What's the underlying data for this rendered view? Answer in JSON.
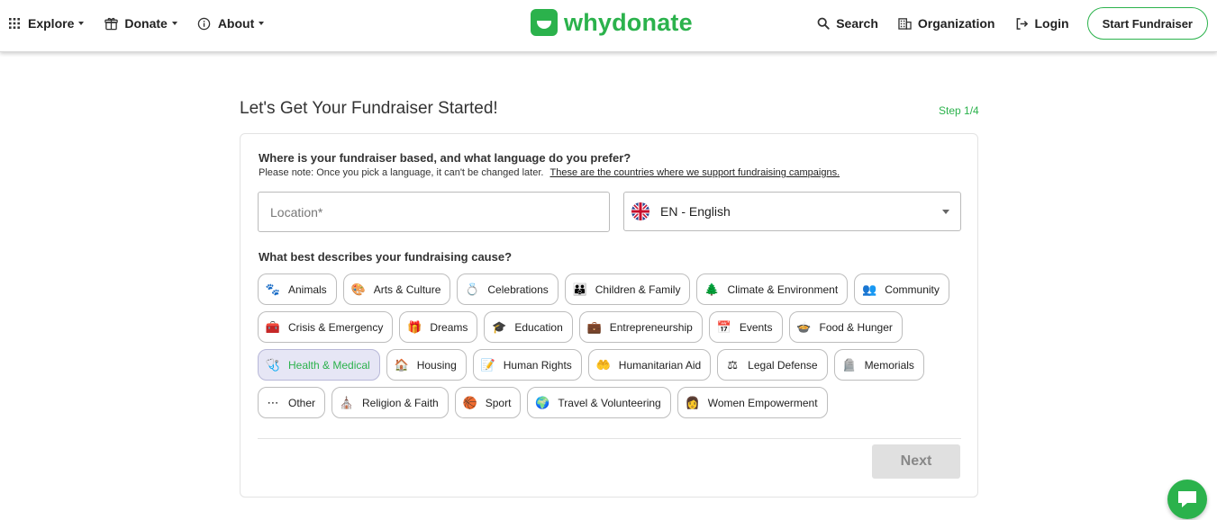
{
  "header": {
    "nav_left": [
      {
        "label": "Explore",
        "icon": "grid-icon"
      },
      {
        "label": "Donate",
        "icon": "gift-box-icon"
      },
      {
        "label": "About",
        "icon": "info-icon"
      }
    ],
    "logo_text": "whydonate",
    "search_label": "Search",
    "organization_label": "Organization",
    "login_label": "Login",
    "start_fundraiser_label": "Start Fundraiser"
  },
  "main": {
    "title": "Let's Get Your Fundraiser Started!",
    "step": "Step 1/4",
    "location_question": "Where is your fundraiser based, and what language do you prefer?",
    "note": "Please note: Once you pick a language, it can't be changed later.",
    "note_link": "These are the countries where we support fundraising campaigns.",
    "location_placeholder": "Location*",
    "language_selected": "EN - English",
    "cause_question": "What best describes your fundraising cause?",
    "next_label": "Next"
  },
  "causes": [
    [
      {
        "label": "Animals",
        "icon": "paw-icon",
        "glyph": "🐾"
      },
      {
        "label": "Arts & Culture",
        "icon": "palette-icon",
        "glyph": "🎨"
      },
      {
        "label": "Celebrations",
        "icon": "rings-icon",
        "glyph": "💍"
      },
      {
        "label": "Children & Family",
        "icon": "children-icon",
        "glyph": "👪"
      },
      {
        "label": "Climate & Environment",
        "icon": "trees-icon",
        "glyph": "🌲"
      },
      {
        "label": "Community",
        "icon": "people-group-icon",
        "glyph": "👥"
      }
    ],
    [
      {
        "label": "Crisis & Emergency",
        "icon": "first-aid-kit-icon",
        "glyph": "🧰"
      },
      {
        "label": "Dreams",
        "icon": "gift-icon",
        "glyph": "🎁"
      },
      {
        "label": "Education",
        "icon": "graduation-cap-icon",
        "glyph": "🎓"
      },
      {
        "label": "Entrepreneurship",
        "icon": "briefcase-icon",
        "glyph": "💼"
      },
      {
        "label": "Events",
        "icon": "calendar-icon",
        "glyph": "📅"
      },
      {
        "label": "Food & Hunger",
        "icon": "food-bowl-icon",
        "glyph": "🍲"
      }
    ],
    [
      {
        "label": "Health & Medical",
        "icon": "stethoscope-icon",
        "glyph": "🩺",
        "selected": true
      },
      {
        "label": "Housing",
        "icon": "house-icon",
        "glyph": "🏠"
      },
      {
        "label": "Human Rights",
        "icon": "document-sign-icon",
        "glyph": "📝"
      },
      {
        "label": "Humanitarian Aid",
        "icon": "helping-hands-icon",
        "glyph": "🤲"
      },
      {
        "label": "Legal Defense",
        "icon": "lawyer-icon",
        "glyph": "⚖"
      },
      {
        "label": "Memorials",
        "icon": "tombstone-icon",
        "glyph": "🪦"
      }
    ],
    [
      {
        "label": "Other",
        "icon": "ellipsis-circle-icon",
        "glyph": "⋯"
      },
      {
        "label": "Religion & Faith",
        "icon": "worship-icon",
        "glyph": "⛪"
      },
      {
        "label": "Sport",
        "icon": "basketball-icon",
        "glyph": "🏀"
      },
      {
        "label": "Travel & Volunteering",
        "icon": "globe-hand-icon",
        "glyph": "🌍"
      },
      {
        "label": "Women Empowerment",
        "icon": "woman-icon",
        "glyph": "👩"
      }
    ]
  ],
  "colors": {
    "brand": "#2bb24c",
    "selected_chip_bg": "#e6e6f5",
    "next_disabled_bg": "#e0e0e0"
  }
}
